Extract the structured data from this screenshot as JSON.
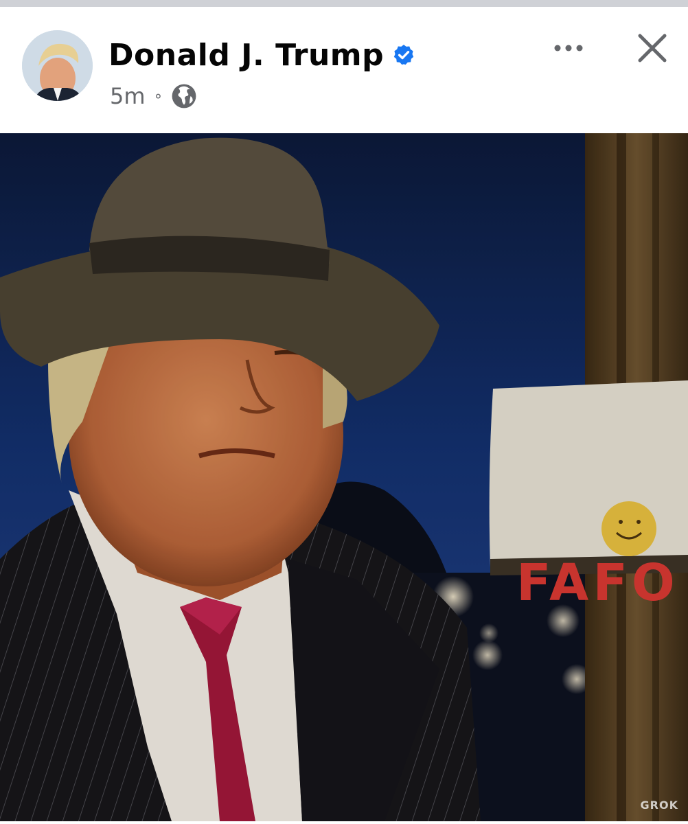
{
  "post": {
    "author_name": "Donald J. Trump",
    "verified": true,
    "timestamp": "5m",
    "separator": "∘",
    "privacy_icon": "globe-icon",
    "more_icon": "more-horizontal-icon",
    "close_icon": "close-icon"
  },
  "image": {
    "sign_text": "FAFO",
    "watermark": "GROK"
  },
  "colors": {
    "verified_blue": "#1877f2",
    "secondary_text": "#65676b",
    "sign_red": "#c8342e"
  }
}
